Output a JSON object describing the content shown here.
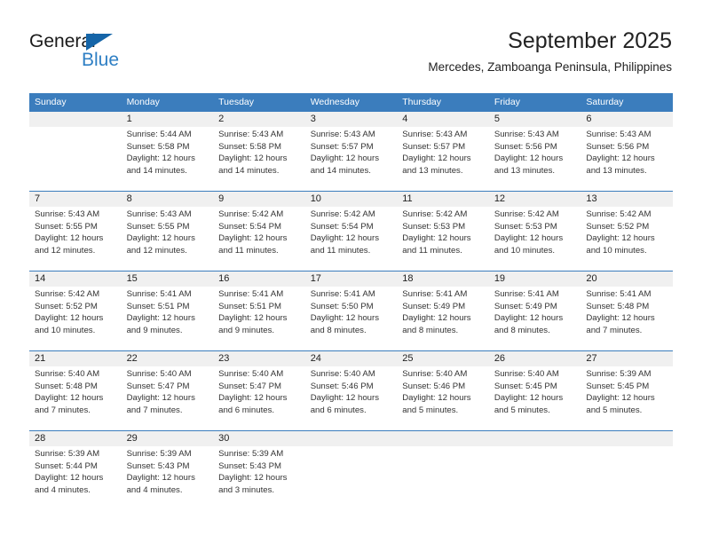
{
  "brand": {
    "name_part1": "General",
    "name_part2": "Blue",
    "triangle_color": "#1565a8",
    "blue_color": "#2e7fc4"
  },
  "header": {
    "title": "September 2025",
    "subtitle": "Mercedes, Zamboanga Peninsula, Philippines"
  },
  "theme": {
    "header_bg": "#3b7dbd",
    "daynum_bg": "#f0f0f0",
    "text": "#333333"
  },
  "calendar": {
    "weekday_headers": [
      "Sunday",
      "Monday",
      "Tuesday",
      "Wednesday",
      "Thursday",
      "Friday",
      "Saturday"
    ],
    "weeks": [
      [
        {
          "day": "",
          "lines": []
        },
        {
          "day": "1",
          "lines": [
            "Sunrise: 5:44 AM",
            "Sunset: 5:58 PM",
            "Daylight: 12 hours",
            "and 14 minutes."
          ]
        },
        {
          "day": "2",
          "lines": [
            "Sunrise: 5:43 AM",
            "Sunset: 5:58 PM",
            "Daylight: 12 hours",
            "and 14 minutes."
          ]
        },
        {
          "day": "3",
          "lines": [
            "Sunrise: 5:43 AM",
            "Sunset: 5:57 PM",
            "Daylight: 12 hours",
            "and 14 minutes."
          ]
        },
        {
          "day": "4",
          "lines": [
            "Sunrise: 5:43 AM",
            "Sunset: 5:57 PM",
            "Daylight: 12 hours",
            "and 13 minutes."
          ]
        },
        {
          "day": "5",
          "lines": [
            "Sunrise: 5:43 AM",
            "Sunset: 5:56 PM",
            "Daylight: 12 hours",
            "and 13 minutes."
          ]
        },
        {
          "day": "6",
          "lines": [
            "Sunrise: 5:43 AM",
            "Sunset: 5:56 PM",
            "Daylight: 12 hours",
            "and 13 minutes."
          ]
        }
      ],
      [
        {
          "day": "7",
          "lines": [
            "Sunrise: 5:43 AM",
            "Sunset: 5:55 PM",
            "Daylight: 12 hours",
            "and 12 minutes."
          ]
        },
        {
          "day": "8",
          "lines": [
            "Sunrise: 5:43 AM",
            "Sunset: 5:55 PM",
            "Daylight: 12 hours",
            "and 12 minutes."
          ]
        },
        {
          "day": "9",
          "lines": [
            "Sunrise: 5:42 AM",
            "Sunset: 5:54 PM",
            "Daylight: 12 hours",
            "and 11 minutes."
          ]
        },
        {
          "day": "10",
          "lines": [
            "Sunrise: 5:42 AM",
            "Sunset: 5:54 PM",
            "Daylight: 12 hours",
            "and 11 minutes."
          ]
        },
        {
          "day": "11",
          "lines": [
            "Sunrise: 5:42 AM",
            "Sunset: 5:53 PM",
            "Daylight: 12 hours",
            "and 11 minutes."
          ]
        },
        {
          "day": "12",
          "lines": [
            "Sunrise: 5:42 AM",
            "Sunset: 5:53 PM",
            "Daylight: 12 hours",
            "and 10 minutes."
          ]
        },
        {
          "day": "13",
          "lines": [
            "Sunrise: 5:42 AM",
            "Sunset: 5:52 PM",
            "Daylight: 12 hours",
            "and 10 minutes."
          ]
        }
      ],
      [
        {
          "day": "14",
          "lines": [
            "Sunrise: 5:42 AM",
            "Sunset: 5:52 PM",
            "Daylight: 12 hours",
            "and 10 minutes."
          ]
        },
        {
          "day": "15",
          "lines": [
            "Sunrise: 5:41 AM",
            "Sunset: 5:51 PM",
            "Daylight: 12 hours",
            "and 9 minutes."
          ]
        },
        {
          "day": "16",
          "lines": [
            "Sunrise: 5:41 AM",
            "Sunset: 5:51 PM",
            "Daylight: 12 hours",
            "and 9 minutes."
          ]
        },
        {
          "day": "17",
          "lines": [
            "Sunrise: 5:41 AM",
            "Sunset: 5:50 PM",
            "Daylight: 12 hours",
            "and 8 minutes."
          ]
        },
        {
          "day": "18",
          "lines": [
            "Sunrise: 5:41 AM",
            "Sunset: 5:49 PM",
            "Daylight: 12 hours",
            "and 8 minutes."
          ]
        },
        {
          "day": "19",
          "lines": [
            "Sunrise: 5:41 AM",
            "Sunset: 5:49 PM",
            "Daylight: 12 hours",
            "and 8 minutes."
          ]
        },
        {
          "day": "20",
          "lines": [
            "Sunrise: 5:41 AM",
            "Sunset: 5:48 PM",
            "Daylight: 12 hours",
            "and 7 minutes."
          ]
        }
      ],
      [
        {
          "day": "21",
          "lines": [
            "Sunrise: 5:40 AM",
            "Sunset: 5:48 PM",
            "Daylight: 12 hours",
            "and 7 minutes."
          ]
        },
        {
          "day": "22",
          "lines": [
            "Sunrise: 5:40 AM",
            "Sunset: 5:47 PM",
            "Daylight: 12 hours",
            "and 7 minutes."
          ]
        },
        {
          "day": "23",
          "lines": [
            "Sunrise: 5:40 AM",
            "Sunset: 5:47 PM",
            "Daylight: 12 hours",
            "and 6 minutes."
          ]
        },
        {
          "day": "24",
          "lines": [
            "Sunrise: 5:40 AM",
            "Sunset: 5:46 PM",
            "Daylight: 12 hours",
            "and 6 minutes."
          ]
        },
        {
          "day": "25",
          "lines": [
            "Sunrise: 5:40 AM",
            "Sunset: 5:46 PM",
            "Daylight: 12 hours",
            "and 5 minutes."
          ]
        },
        {
          "day": "26",
          "lines": [
            "Sunrise: 5:40 AM",
            "Sunset: 5:45 PM",
            "Daylight: 12 hours",
            "and 5 minutes."
          ]
        },
        {
          "day": "27",
          "lines": [
            "Sunrise: 5:39 AM",
            "Sunset: 5:45 PM",
            "Daylight: 12 hours",
            "and 5 minutes."
          ]
        }
      ],
      [
        {
          "day": "28",
          "lines": [
            "Sunrise: 5:39 AM",
            "Sunset: 5:44 PM",
            "Daylight: 12 hours",
            "and 4 minutes."
          ]
        },
        {
          "day": "29",
          "lines": [
            "Sunrise: 5:39 AM",
            "Sunset: 5:43 PM",
            "Daylight: 12 hours",
            "and 4 minutes."
          ]
        },
        {
          "day": "30",
          "lines": [
            "Sunrise: 5:39 AM",
            "Sunset: 5:43 PM",
            "Daylight: 12 hours",
            "and 3 minutes."
          ]
        },
        {
          "day": "",
          "lines": []
        },
        {
          "day": "",
          "lines": []
        },
        {
          "day": "",
          "lines": []
        },
        {
          "day": "",
          "lines": []
        }
      ]
    ]
  }
}
